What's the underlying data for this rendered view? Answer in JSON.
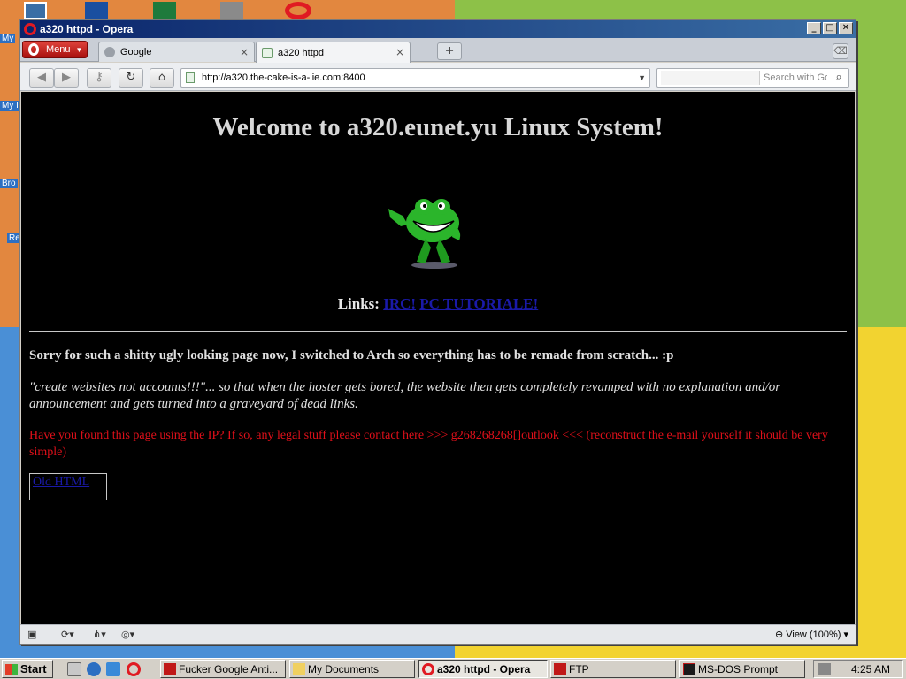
{
  "desktop": {
    "icons": [
      {
        "name": "computer-icon",
        "color": "#3a6ea5"
      },
      {
        "name": "outlook-icon",
        "color": "#1a4fa0"
      },
      {
        "name": "excel-icon",
        "color": "#1e7a3c"
      },
      {
        "name": "clock-icon",
        "color": "#6a6a6a"
      },
      {
        "name": "opera-icon",
        "color": "#e01a22"
      }
    ],
    "labels": [
      "My",
      "My I",
      "Bro",
      "Re"
    ]
  },
  "window": {
    "title": "a320 httpd - Opera",
    "min_label": "_",
    "max_label": "□",
    "close_label": "✕"
  },
  "browser": {
    "menu_label": "Menu",
    "tabs": [
      {
        "label": "Google",
        "active": false
      },
      {
        "label": "a320 httpd",
        "active": true
      }
    ],
    "new_tab_label": "+",
    "url": "http://a320.the-cake-is-a-lie.com:8400",
    "search_placeholder": "Search with Go"
  },
  "page": {
    "title": "Welcome to a320.eunet.yu Linux System!",
    "links_label": "Links:",
    "links": [
      "IRC!",
      "PC TUTORIALE!"
    ],
    "p1": "Sorry for such a shitty ugly looking page now, I switched to Arch so everything has to be remade from scratch... :p",
    "p2": "\"create websites not accounts!!!\"... so that when the hoster gets bored, the website then gets completely revamped with no explanation and/or announcement and gets turned into a graveyard of dead links.",
    "p3": "Have you found this page using the IP? If so, any legal stuff please contact here >>> g268268268[]outlook <<< (reconstruct the e-mail yourself it should be very simple)",
    "old_html_label": "Old HTML"
  },
  "statusbar": {
    "zoom_label": "View (100%)"
  },
  "taskbar": {
    "start_label": "Start",
    "tasks": [
      {
        "label": "Fucker Google Anti...",
        "active": false
      },
      {
        "label": "My Documents",
        "active": false
      },
      {
        "label": "a320 httpd - Opera",
        "active": true
      },
      {
        "label": "FTP",
        "active": false
      },
      {
        "label": "MS-DOS Prompt",
        "active": false
      }
    ],
    "clock": "4:25 AM"
  }
}
